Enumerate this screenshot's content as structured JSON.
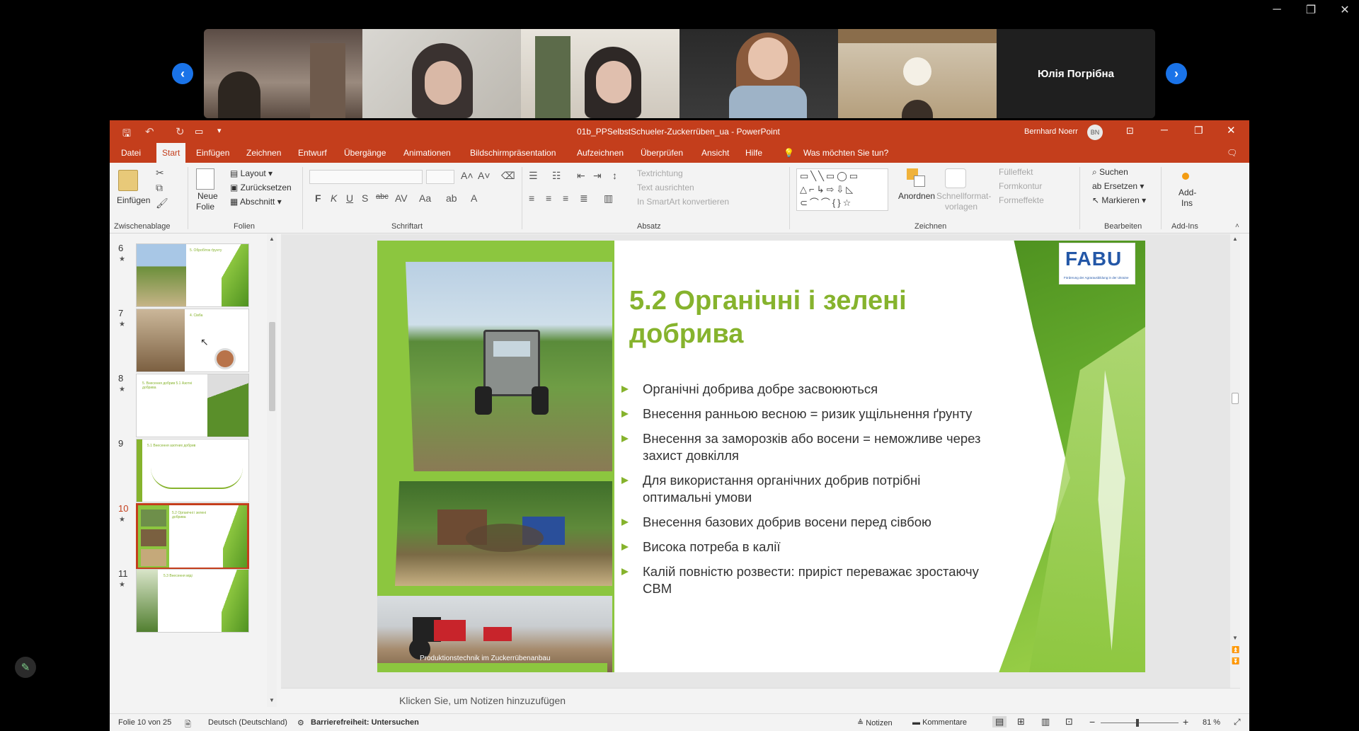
{
  "meeting": {
    "participant_name": "Юлія Погрібна",
    "prev_icon": "chevron-left-icon",
    "next_icon": "chevron-right-icon",
    "accent": "#1a73e8"
  },
  "window": {
    "title": "01b_PPSelbstSchueler-Zuckerrüben_ua  -  PowerPoint",
    "user": "Bernhard Noerr",
    "user_initials": "BN",
    "accent": "#c43e1c"
  },
  "tabs": [
    "Datei",
    "Start",
    "Einfügen",
    "Zeichnen",
    "Entwurf",
    "Übergänge",
    "Animationen",
    "Bildschirmpräsentation",
    "Aufzeichnen",
    "Überprüfen",
    "Ansicht",
    "Hilfe"
  ],
  "active_tab": "Start",
  "tell_me": "Was möchten Sie tun?",
  "ribbon": {
    "paste": "Einfügen",
    "clipboard": "Zwischenablage",
    "new_slide_1": "Neue",
    "new_slide_2": "Folie",
    "layout": "Layout",
    "reset": "Zurücksetzen",
    "section": "Abschnitt",
    "slides_group": "Folien",
    "font_group": "Schriftart",
    "paragraph_group": "Absatz",
    "text_direction": "Textrichtung",
    "align_text": "Text ausrichten",
    "smartart": "In SmartArt konvertieren",
    "drawing_group": "Zeichnen",
    "arrange": "Anordnen",
    "quick_styles_1": "Schnellformat-",
    "quick_styles_2": "vorlagen",
    "fill": "Fülleffekt",
    "outline": "Formkontur",
    "effects": "Formeffekte",
    "find": "Suchen",
    "replace": "Ersetzen",
    "select": "Markieren",
    "editing_group": "Bearbeiten",
    "addins_1": "Add-",
    "addins_2": "Ins",
    "addins_group": "Add-Ins"
  },
  "thumbnails": [
    {
      "num": "6",
      "title": "5. Обробіток ґрунту"
    },
    {
      "num": "7",
      "title": "4. Сівба"
    },
    {
      "num": "8",
      "title": "5. Внесення добрив 5.1 Азотні добрива"
    },
    {
      "num": "9",
      "title": "5.1 Внесення азотних добрив"
    },
    {
      "num": "10",
      "title": "5.2 Органічні і зелені добрива"
    },
    {
      "num": "11",
      "title": "5.3 Внесення міді"
    }
  ],
  "selected_slide": "10",
  "slide": {
    "title": "5.2 Органічні і зелені добрива",
    "caption": "Produktionstechnik im Zuckerrübenanbau",
    "logo_text": "FABU",
    "logo_sub": "Förderung der Agrarausbildung in der Ukraine",
    "bullets": [
      "Органічні добрива добре засвоюються",
      "Внесення ранньою весною = ризик ущільнення ґрунту",
      "Внесення за заморозків або восени = неможливе через захист довкілля",
      "Для використання органічних добрив потрібні оптимальні умови",
      "Внесення базових добрив восени перед сівбою",
      "Висока потреба в калії",
      "Калій повністю розвести: приріст переважає зростаючу СВМ"
    ]
  },
  "notes_placeholder": "Klicken Sie, um Notizen hinzuzufügen",
  "status": {
    "slide_of": "Folie 10 von 25",
    "language": "Deutsch (Deutschland)",
    "accessibility": "Barrierefreiheit: Untersuchen",
    "notes": "Notizen",
    "comments": "Kommentare",
    "zoom": "81 %"
  }
}
